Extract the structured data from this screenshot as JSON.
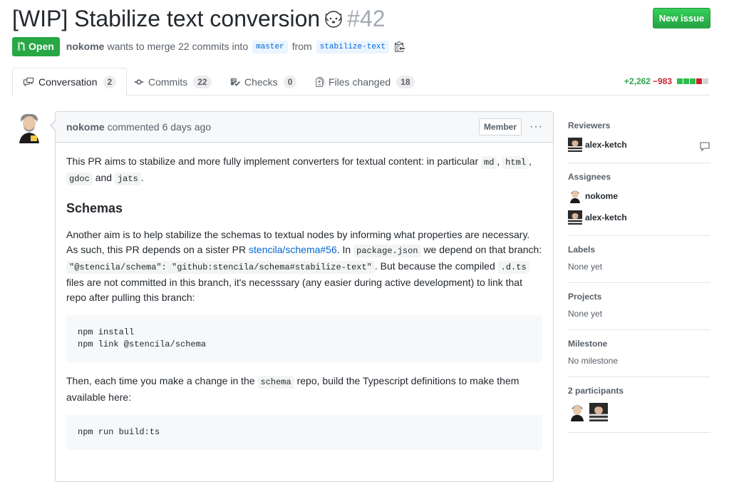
{
  "header": {
    "title": "[WIP] Stabilize text conversion",
    "number": "#42",
    "new_issue_label": "New issue"
  },
  "meta": {
    "state": "Open",
    "author": "nokome",
    "text_merge": "wants to merge 22 commits into",
    "base_branch": "master",
    "text_from": "from",
    "head_branch": "stabilize-text"
  },
  "tabs": [
    {
      "label": "Conversation",
      "count": "2"
    },
    {
      "label": "Commits",
      "count": "22"
    },
    {
      "label": "Checks",
      "count": "0"
    },
    {
      "label": "Files changed",
      "count": "18"
    }
  ],
  "diffstat": {
    "additions": "+2,262",
    "deletions": "−983"
  },
  "comment": {
    "author": "nokome",
    "action": "commented 6 days ago",
    "badge": "Member",
    "p1": {
      "pre": "This PR aims to stabilize and more fully implement converters for textual content: in particular",
      "c1": "md",
      "sep1": ",",
      "c2": "html",
      "sep2": ",",
      "c3": "gdoc",
      "and": "and",
      "c4": "jats",
      "end": "."
    },
    "heading": "Schemas",
    "p2": {
      "t1": "Another aim is to help stabilize the schemas to textual nodes by informing what properties are necessary. As such, this PR depends on a sister PR",
      "link": "stencila/schema#56",
      "t2": ". In",
      "c1": "package.json",
      "t3": "we depend on that branch:",
      "c2": "\"@stencila/schema\": \"github:stencila/schema#stabilize-text\"",
      "t4": ". But because the compiled",
      "c3": ".d.ts",
      "t5": "files are not committed in this branch, it's necesssary (any easier during active development) to link that repo after pulling this branch:"
    },
    "code1": "npm install\nnpm link @stencila/schema",
    "p3": {
      "t1": "Then, each time you make a change in the",
      "c1": "schema",
      "t2": "repo, build the Typescript definitions to make them available here:"
    },
    "code2": "npm run build:ts"
  },
  "sidebar": {
    "reviewers": {
      "title": "Reviewers",
      "people": [
        "alex-ketch"
      ]
    },
    "assignees": {
      "title": "Assignees",
      "people": [
        "nokome",
        "alex-ketch"
      ]
    },
    "labels": {
      "title": "Labels",
      "value": "None yet"
    },
    "projects": {
      "title": "Projects",
      "value": "None yet"
    },
    "milestone": {
      "title": "Milestone",
      "value": "No milestone"
    },
    "participants": {
      "title": "2 participants"
    }
  },
  "colors": {
    "green": "#28a745",
    "red": "#cb2431",
    "link": "#0366d6"
  }
}
